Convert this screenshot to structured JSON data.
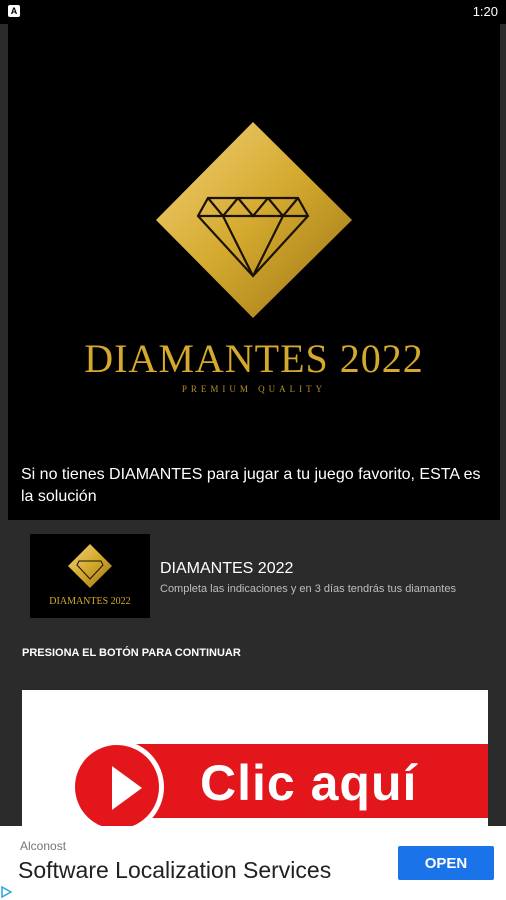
{
  "status_bar": {
    "time": "1:20",
    "app_icon_letter": "A"
  },
  "hero": {
    "logo_title": "DIAMANTES 2022",
    "logo_tagline": "PREMIUM QUALITY",
    "caption": "Si no tienes DIAMANTES para jugar a tu juego favorito, ESTA es la solución"
  },
  "card": {
    "thumb_title": "DIAMANTES 2022",
    "title": "DIAMANTES 2022",
    "subtitle": "Completa las indicaciones y en 3 días tendrás tus diamantes"
  },
  "instruction": "PRESIONA EL BOTÓN PARA CONTINUAR",
  "banner": {
    "label": "Clic aquí"
  },
  "ad": {
    "advertiser": "Alconost",
    "headline": "Software Localization Services",
    "cta": "OPEN"
  },
  "colors": {
    "gold": "#d4a92e",
    "banner_red": "#e3161b",
    "ad_button_blue": "#1a73e8"
  }
}
